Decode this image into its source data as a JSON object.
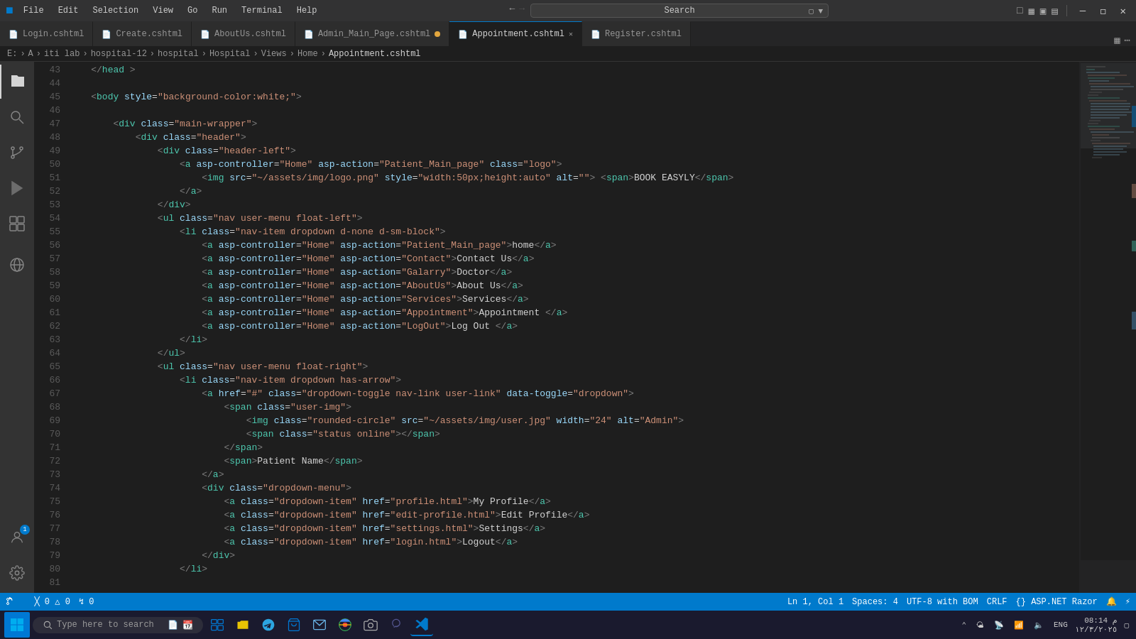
{
  "titlebar": {
    "menus": [
      "File",
      "Edit",
      "Selection",
      "View",
      "Go",
      "Run",
      "Terminal",
      "Help"
    ],
    "search_placeholder": "Search",
    "nav_back": "←",
    "nav_forward": "→",
    "window_btns": [
      "🗕",
      "🗗",
      "✕"
    ]
  },
  "tabs": [
    {
      "label": "Login.cshtml",
      "modified": false,
      "active": false
    },
    {
      "label": "Create.cshtml",
      "modified": false,
      "active": false
    },
    {
      "label": "AboutUs.cshtml",
      "modified": false,
      "active": false
    },
    {
      "label": "Admin_Main_Page.cshtml",
      "modified": true,
      "active": false
    },
    {
      "label": "Appointment.cshtml",
      "modified": false,
      "active": true
    },
    {
      "label": "Register.cshtml",
      "modified": false,
      "active": false
    }
  ],
  "breadcrumb": {
    "parts": [
      "E:",
      "A",
      "iti lab",
      "hospital-12",
      "hospital",
      "Hospital",
      "Views",
      "Home",
      "Appointment.cshtml"
    ]
  },
  "activity_bar": {
    "icons": [
      {
        "name": "explorer",
        "symbol": "⬜",
        "active": true,
        "badge": null
      },
      {
        "name": "search",
        "symbol": "🔍",
        "active": false,
        "badge": null
      },
      {
        "name": "source-control",
        "symbol": "⑂",
        "active": false,
        "badge": null
      },
      {
        "name": "run-debug",
        "symbol": "▷",
        "active": false,
        "badge": null
      },
      {
        "name": "extensions",
        "symbol": "⧉",
        "active": false,
        "badge": null
      },
      {
        "name": "remote",
        "symbol": "◎",
        "active": false,
        "badge": null
      }
    ],
    "bottom_icons": [
      {
        "name": "account",
        "symbol": "👤",
        "badge": "1"
      },
      {
        "name": "settings",
        "symbol": "⚙"
      }
    ]
  },
  "code_lines": [
    {
      "num": 43,
      "content": "    </head >"
    },
    {
      "num": 44,
      "content": ""
    },
    {
      "num": 45,
      "content": "    <body style=\"background-color:white;\">"
    },
    {
      "num": 46,
      "content": ""
    },
    {
      "num": 47,
      "content": "        <div class=\"main-wrapper\">"
    },
    {
      "num": 48,
      "content": "            <div class=\"header\">"
    },
    {
      "num": 49,
      "content": "                <div class=\"header-left\">"
    },
    {
      "num": 50,
      "content": "                    <a asp-controller=\"Home\" asp-action=\"Patient_Main_page\" class=\"logo\">"
    },
    {
      "num": 51,
      "content": "                        <img src=\"~/assets/img/logo.png\" style=\"width:50px;height:auto\" alt=\"\"> <span>BOOK EASYLY</span>"
    },
    {
      "num": 52,
      "content": "                    </a>"
    },
    {
      "num": 53,
      "content": "                </div>"
    },
    {
      "num": 54,
      "content": "                <ul class=\"nav user-menu float-left\">"
    },
    {
      "num": 55,
      "content": "                    <li class=\"nav-item dropdown d-none d-sm-block\">"
    },
    {
      "num": 56,
      "content": "                        <a asp-controller=\"Home\" asp-action=\"Patient_Main_page\">home</a>"
    },
    {
      "num": 57,
      "content": "                        <a asp-controller=\"Home\" asp-action=\"Contact\">Contact Us</a>"
    },
    {
      "num": 58,
      "content": "                        <a asp-controller=\"Home\" asp-action=\"Galarry\">Doctor</a>"
    },
    {
      "num": 59,
      "content": "                        <a asp-controller=\"Home\" asp-action=\"AboutUs\">About Us</a>"
    },
    {
      "num": 60,
      "content": "                        <a asp-controller=\"Home\" asp-action=\"Services\">Services</a>"
    },
    {
      "num": 61,
      "content": "                        <a asp-controller=\"Home\" asp-action=\"Appointment\">Appointment </a>"
    },
    {
      "num": 62,
      "content": "                        <a asp-controller=\"Home\" asp-action=\"LogOut\">Log Out </a>"
    },
    {
      "num": 63,
      "content": "                    </li>"
    },
    {
      "num": 64,
      "content": "                </ul>"
    },
    {
      "num": 65,
      "content": "                <ul class=\"nav user-menu float-right\">"
    },
    {
      "num": 66,
      "content": "                    <li class=\"nav-item dropdown has-arrow\">"
    },
    {
      "num": 67,
      "content": "                        <a href=\"#\" class=\"dropdown-toggle nav-link user-link\" data-toggle=\"dropdown\">"
    },
    {
      "num": 68,
      "content": "                            <span class=\"user-img\">"
    },
    {
      "num": 69,
      "content": "                                <img class=\"rounded-circle\" src=\"~/assets/img/user.jpg\" width=\"24\" alt=\"Admin\">"
    },
    {
      "num": 70,
      "content": "                                <span class=\"status online\"></span>"
    },
    {
      "num": 71,
      "content": "                            </span>"
    },
    {
      "num": 72,
      "content": "                            <span>Patient Name</span>"
    },
    {
      "num": 73,
      "content": "                        </a>"
    },
    {
      "num": 74,
      "content": "                        <div class=\"dropdown-menu\">"
    },
    {
      "num": 75,
      "content": "                            <a class=\"dropdown-item\" href=\"profile.html\">My Profile</a>"
    },
    {
      "num": 76,
      "content": "                            <a class=\"dropdown-item\" href=\"edit-profile.html\">Edit Profile</a>"
    },
    {
      "num": 77,
      "content": "                            <a class=\"dropdown-item\" href=\"settings.html\">Settings</a>"
    },
    {
      "num": 78,
      "content": "                            <a class=\"dropdown-item\" href=\"login.html\">Logout</a>"
    },
    {
      "num": 79,
      "content": "                        </div>"
    },
    {
      "num": 80,
      "content": "                    </li>"
    },
    {
      "num": 81,
      "content": ""
    }
  ],
  "status_bar": {
    "left_items": [
      "⎇",
      "0  0",
      "⚠ 0",
      "✓ 0"
    ],
    "right_items": [
      "Ln 1, Col 1",
      "Spaces: 4",
      "UTF-8 with BOM",
      "CRLF",
      "{} ASP.NET Razor",
      "🔔",
      "⚡"
    ]
  },
  "taskbar": {
    "search_placeholder": "Type here to search",
    "icons": [
      "📋",
      "📁",
      "✈",
      "🛍",
      "✉",
      "🦅",
      "📷",
      "👥",
      "🖥"
    ],
    "system_icons": [
      "🌤",
      "🔵",
      "📶",
      "🔊",
      "ENG"
    ],
    "time": "08:14 م",
    "date": "١٢/٣/٢٠٢٥"
  }
}
